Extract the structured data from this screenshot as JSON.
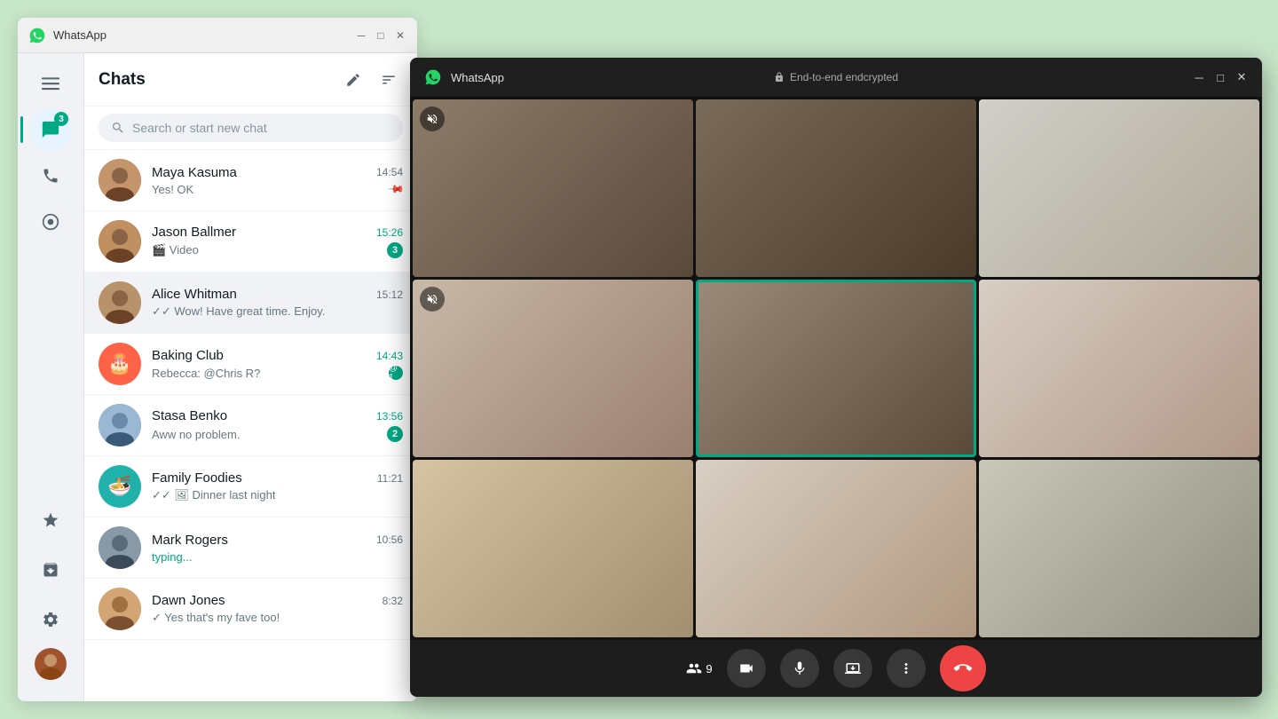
{
  "app": {
    "title": "WhatsApp",
    "title_bar_bg": "#f0f0f0"
  },
  "sidebar": {
    "badge_count": "3",
    "icons": [
      {
        "name": "menu",
        "symbol": "☰",
        "active": false
      },
      {
        "name": "chats",
        "symbol": "💬",
        "active": true,
        "badge": "3"
      },
      {
        "name": "calls",
        "symbol": "📞",
        "active": false
      },
      {
        "name": "status",
        "symbol": "⊙",
        "active": false
      },
      {
        "name": "starred",
        "symbol": "★",
        "active": false
      },
      {
        "name": "archived",
        "symbol": "🗂",
        "active": false
      },
      {
        "name": "settings",
        "symbol": "⚙",
        "active": false
      }
    ]
  },
  "chats_panel": {
    "title": "Chats",
    "new_chat_icon": "✎",
    "filter_icon": "≡",
    "search_placeholder": "Search or start new chat",
    "items": [
      {
        "id": 1,
        "name": "Maya Kasuma",
        "preview": "Yes! OK",
        "time": "14:54",
        "time_unread": false,
        "unread": 0,
        "pinned": true,
        "avatar_color": "#a0522d",
        "avatar_emoji": "👩"
      },
      {
        "id": 2,
        "name": "Jason Ballmer",
        "preview": "🎬 Video",
        "time": "15:26",
        "time_unread": true,
        "unread": 3,
        "pinned": false,
        "avatar_color": "#8b4513",
        "avatar_emoji": "👫"
      },
      {
        "id": 3,
        "name": "Alice Whitman",
        "preview": "✓✓ Wow! Have great time. Enjoy.",
        "time": "15:12",
        "time_unread": false,
        "unread": 0,
        "active": true,
        "pinned": false,
        "avatar_color": "#cd853f",
        "avatar_emoji": "👩"
      },
      {
        "id": 4,
        "name": "Baking Club",
        "preview": "Rebecca: @Chris R?",
        "time": "14:43",
        "time_unread": true,
        "unread": 1,
        "mention": true,
        "pinned": false,
        "avatar_color": "#ff6347",
        "avatar_emoji": "🎂"
      },
      {
        "id": 5,
        "name": "Stasa Benko",
        "preview": "Aww no problem.",
        "time": "13:56",
        "time_unread": true,
        "unread": 2,
        "pinned": false,
        "avatar_color": "#4682b4",
        "avatar_emoji": "👩"
      },
      {
        "id": 6,
        "name": "Family Foodies",
        "preview": "✓✓ 🖼 Dinner last night",
        "time": "11:21",
        "time_unread": false,
        "unread": 0,
        "pinned": false,
        "avatar_color": "#20b2aa",
        "avatar_emoji": "🍜"
      },
      {
        "id": 7,
        "name": "Mark Rogers",
        "preview": "typing...",
        "time": "10:56",
        "time_unread": false,
        "unread": 0,
        "typing": true,
        "pinned": false,
        "avatar_color": "#708090",
        "avatar_emoji": "👨"
      },
      {
        "id": 8,
        "name": "Dawn Jones",
        "preview": "✓ Yes that's my fave too!",
        "time": "8:32",
        "time_unread": false,
        "unread": 0,
        "pinned": false,
        "avatar_color": "#bc8f5f",
        "avatar_emoji": "👨"
      }
    ]
  },
  "call_window": {
    "title": "WhatsApp",
    "e2e_label": "End-to-end endcrypted",
    "participant_count": "9",
    "controls": [
      {
        "name": "participants",
        "symbol": "👥",
        "label": "participants"
      },
      {
        "name": "camera",
        "symbol": "📹",
        "label": "camera"
      },
      {
        "name": "microphone",
        "symbol": "🎤",
        "label": "microphone"
      },
      {
        "name": "screen-share",
        "symbol": "⬆",
        "label": "screen share"
      },
      {
        "name": "more",
        "symbol": "•••",
        "label": "more"
      },
      {
        "name": "end-call",
        "symbol": "📞",
        "label": "end call"
      }
    ]
  }
}
